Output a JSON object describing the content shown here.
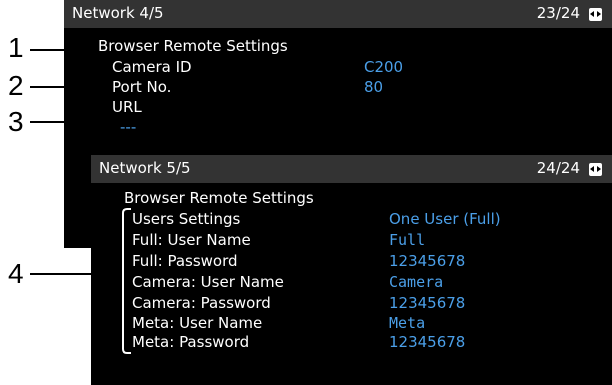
{
  "callouts": {
    "c1": "1",
    "c2": "2",
    "c3": "3",
    "c4": "4"
  },
  "screen1": {
    "title": "Network 4/5",
    "page": "23/24",
    "section": "Browser Remote Settings",
    "rows": [
      {
        "label": "Camera ID",
        "value": "C200"
      },
      {
        "label": "Port No.",
        "value": "80"
      },
      {
        "label": "URL",
        "value": "---"
      }
    ]
  },
  "screen2": {
    "title": "Network 5/5",
    "page": "24/24",
    "section": "Browser Remote Settings",
    "rows": [
      {
        "label": "Users Settings",
        "value": "One User (Full)"
      },
      {
        "label": "Full: User Name",
        "value": "Full"
      },
      {
        "label": "Full: Password",
        "value": "12345678"
      },
      {
        "label": "Camera: User Name",
        "value": "Camera"
      },
      {
        "label": "Camera: Password",
        "value": "12345678"
      },
      {
        "label": "Meta: User Name",
        "value": "Meta"
      },
      {
        "label": "Meta: Password",
        "value": "12345678"
      }
    ]
  },
  "icons": {
    "page_nav": "left-right-arrows-icon"
  },
  "colors": {
    "value_text": "#4b9fe8",
    "header_bg": "#333333",
    "screen_bg": "#000000"
  }
}
